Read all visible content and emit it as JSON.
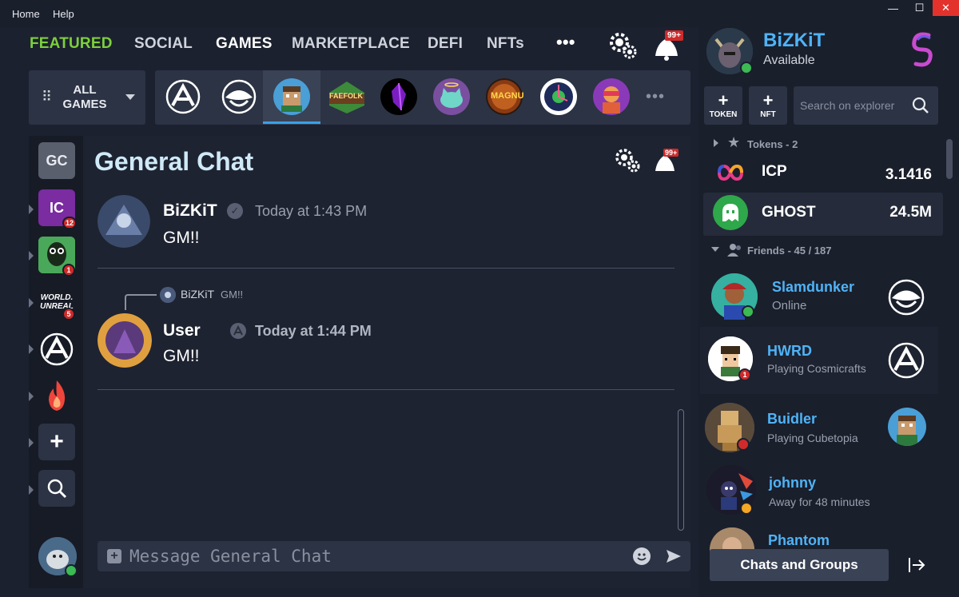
{
  "menu": {
    "home": "Home",
    "help": "Help"
  },
  "window_controls": {
    "minimize": "—",
    "maximize": "☐",
    "close": "✕"
  },
  "nav": {
    "featured": "FEATURED",
    "social": "SOCIAL",
    "games": "GAMES",
    "marketplace": "MARKETPLACE",
    "defi": "DEFI",
    "nfts": "NFTs",
    "more": "•••",
    "notif_badge": "99+"
  },
  "games_bar": {
    "all_games_line1": "ALL",
    "all_games_line2": "GAMES",
    "faefolk_label": "FAEFOLK",
    "magnu_label": "MAGNU",
    "more": "•••"
  },
  "servers": {
    "gc": "GC",
    "ic": "IC",
    "ic_badge": "12",
    "srv3_badge": "1",
    "world_unreal_line1": "WORLD.",
    "world_unreal_line2": "UNREAL",
    "world_unreal_badge": "5"
  },
  "chat": {
    "title": "General Chat",
    "notif_badge": "99+",
    "messages": [
      {
        "name": "BiZKiT",
        "time": "Today at 1:43 PM",
        "text": "GM!!"
      },
      {
        "reply_name": "BiZKiT",
        "reply_text": "GM!!",
        "name": "User",
        "time": "Today at 1:44 PM",
        "text": "GM!!"
      }
    ],
    "input_placeholder": "Message General Chat"
  },
  "profile": {
    "name": "BiZKiT",
    "status": "Available"
  },
  "actions": {
    "token_label": "TOKEN",
    "nft_label": "NFT",
    "plus": "+",
    "search_placeholder": "Search on explorer"
  },
  "tokens": {
    "header": "Tokens - 2",
    "items": [
      {
        "name": "ICP",
        "value": "3.1416"
      },
      {
        "name": "GHOST",
        "value": "24.5M"
      }
    ]
  },
  "friends": {
    "header": "Friends - 45 / 187",
    "items": [
      {
        "name": "Slamdunker",
        "status": "Online"
      },
      {
        "name": "HWRD",
        "status": "Playing Cosmicrafts",
        "badge": "1"
      },
      {
        "name": "Buidler",
        "status": "Playing Cubetopia"
      },
      {
        "name": "johnny",
        "status": "Away for 48 minutes"
      },
      {
        "name": "Phantom",
        "status": ""
      }
    ]
  },
  "chats_groups": "Chats and Groups",
  "colors": {
    "accent_green": "#7dd03a",
    "accent_blue": "#4fb3f6",
    "online": "#3cba54",
    "badge_red": "#d02a2a"
  }
}
